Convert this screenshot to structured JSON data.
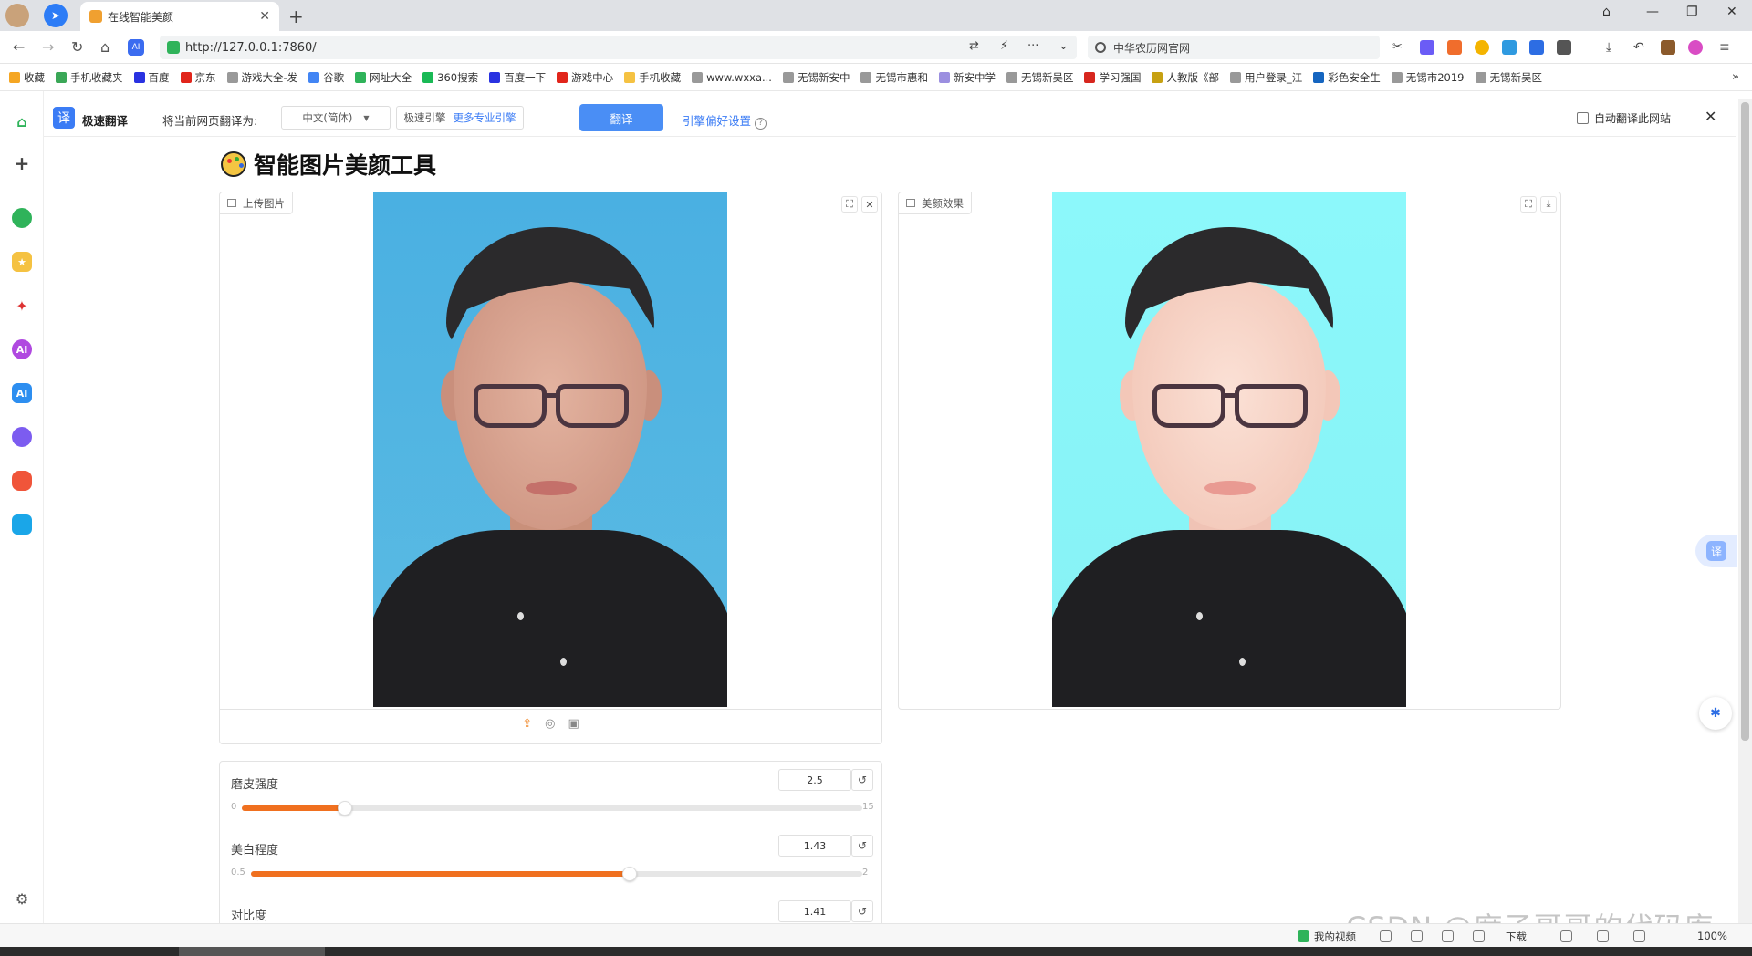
{
  "browser": {
    "tab_title": "在线智能美颜",
    "url": "http://127.0.0.1:7860/",
    "search_text": "中华农历网官网"
  },
  "bookmarks": [
    {
      "label": "收藏",
      "icon": "star-icon",
      "color": "#f5a623"
    },
    {
      "label": "手机收藏夹",
      "icon": "phone-icon",
      "color": "#3aa757"
    },
    {
      "label": "百度",
      "icon": "baidu-paw-icon",
      "color": "#2932e1"
    },
    {
      "label": "京东",
      "icon": "jd-icon",
      "color": "#e1251b"
    },
    {
      "label": "游戏大全-发",
      "icon": "globe-icon",
      "color": "#999999"
    },
    {
      "label": "谷歌",
      "icon": "google-icon",
      "color": "#4285f4"
    },
    {
      "label": "网址大全",
      "icon": "site-nav-icon",
      "color": "#2fb35a"
    },
    {
      "label": "360搜索",
      "icon": "360-icon",
      "color": "#19b955"
    },
    {
      "label": "百度一下",
      "icon": "baidu-paw-icon",
      "color": "#2932e1"
    },
    {
      "label": "游戏中心",
      "icon": "game-center-icon",
      "color": "#e1251b"
    },
    {
      "label": "手机收藏",
      "icon": "folder-icon",
      "color": "#f5c242"
    },
    {
      "label": "www.wxxa...",
      "icon": "globe-icon",
      "color": "#999999"
    },
    {
      "label": "无锡新安中",
      "icon": "globe-icon",
      "color": "#999999"
    },
    {
      "label": "无锡市惠和",
      "icon": "globe-icon",
      "color": "#999999"
    },
    {
      "label": "新安中学",
      "icon": "school-icon",
      "color": "#9b8fe0"
    },
    {
      "label": "无锡新吴区",
      "icon": "globe-icon",
      "color": "#999999"
    },
    {
      "label": "学习强国",
      "icon": "xuexi-icon",
      "color": "#d7261e"
    },
    {
      "label": "人教版《部",
      "icon": "pep-icon",
      "color": "#c7a112"
    },
    {
      "label": "用户登录_江",
      "icon": "globe-icon",
      "color": "#999999"
    },
    {
      "label": "彩色安全生",
      "icon": "p-icon",
      "color": "#1565c0"
    },
    {
      "label": "无锡市2019",
      "icon": "globe-icon",
      "color": "#999999"
    },
    {
      "label": "无锡新吴区",
      "icon": "globe-icon",
      "color": "#999999"
    }
  ],
  "translate_bar": {
    "logo_char": "译",
    "name": "极速翻译",
    "prompt": "将当前网页翻译为:",
    "language": "中文(简体)",
    "engine": "极速引擎",
    "more_engines": "更多专业引擎",
    "translate_button": "翻译",
    "preferences": "引擎偏好设置",
    "auto_translate": "自动翻译此网站"
  },
  "page": {
    "title": "智能图片美颜工具",
    "input_panel_label": "上传图片",
    "output_panel_label": "美颜效果"
  },
  "sliders": [
    {
      "label": "磨皮强度",
      "value": 2.5,
      "display": "2.5",
      "min": 0,
      "max": 15,
      "min_label": "0",
      "max_label": "15"
    },
    {
      "label": "美白程度",
      "value": 1.43,
      "display": "1.43",
      "min": 0.5,
      "max": 2,
      "min_label": "0.5",
      "max_label": "2"
    },
    {
      "label": "对比度",
      "value": 1.41,
      "display": "1.41"
    }
  ],
  "statusbar": {
    "my_video": "我的视频",
    "download": "下载",
    "zoom": "100%"
  },
  "watermark": "CSDN @席子哥哥的代码库",
  "colors": {
    "accent": "#f0701f",
    "translate_blue": "#4a8ef5",
    "input_bg": "#4fb3e0",
    "output_bg": "#8cf6f9"
  }
}
